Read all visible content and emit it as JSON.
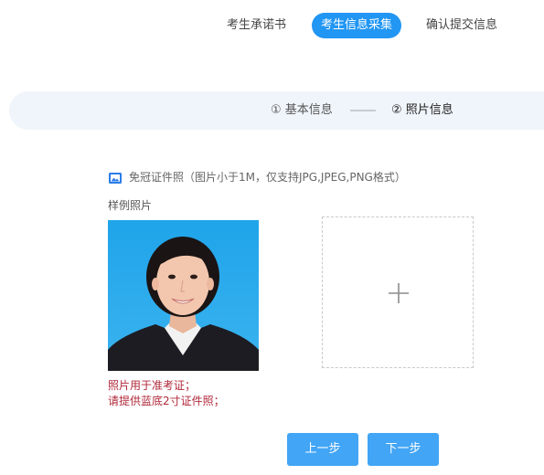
{
  "top_steps": [
    {
      "label": "考生承诺书",
      "active": false
    },
    {
      "label": "考生信息采集",
      "active": true
    },
    {
      "label": "确认提交信息",
      "active": false
    }
  ],
  "sub_steps": [
    {
      "label": "① 基本信息",
      "active": false
    },
    {
      "label": "② 照片信息",
      "active": true
    }
  ],
  "photo_section": {
    "icon": "image-icon",
    "title": "免冠证件照（图片小于1M，仅支持JPG,JPEG,PNG格式）",
    "sample_label": "样例照片",
    "upload_icon": "plus-icon",
    "notes": [
      "照片用于准考证；",
      "请提供蓝底2寸证件照；"
    ]
  },
  "buttons": {
    "prev": "上一步",
    "next": "下一步"
  },
  "colors": {
    "accent": "#2196f3",
    "button": "#42a5f5",
    "note_red": "#b0283a",
    "step_bar_bg": "#f0f5fb",
    "photo_bg": "#29a8e8"
  }
}
